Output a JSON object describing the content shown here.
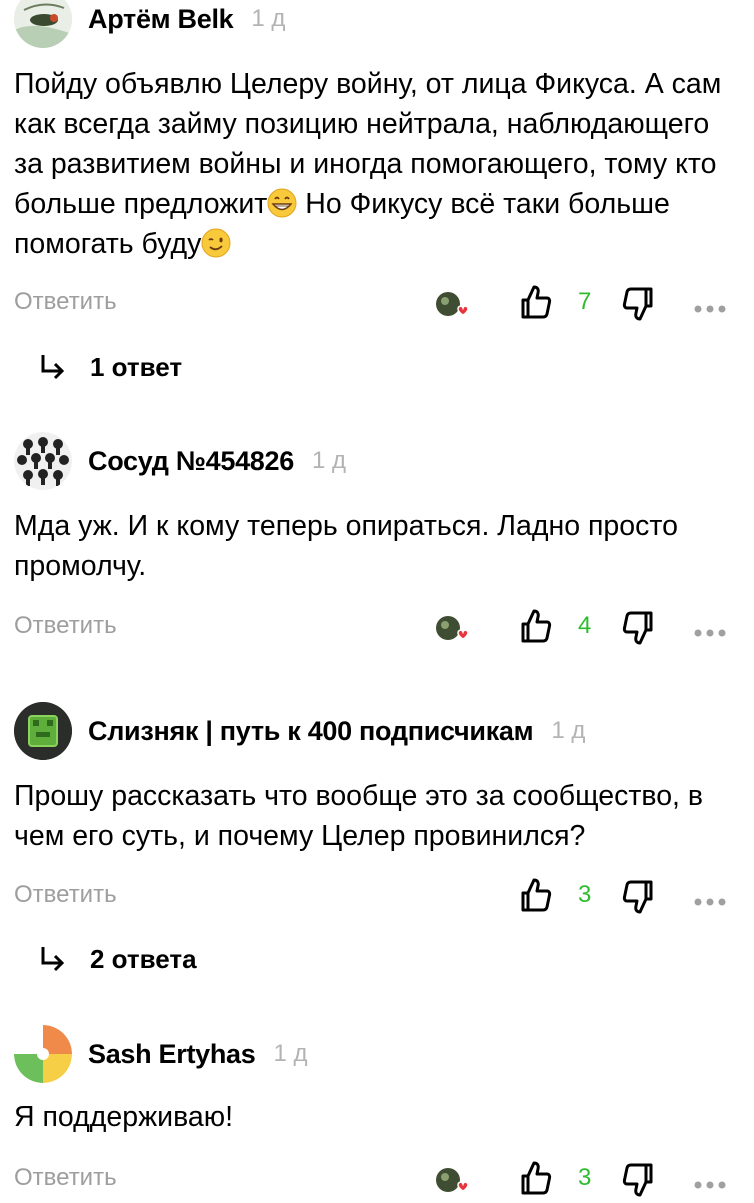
{
  "comments": [
    {
      "author": "Артём Belk",
      "age": "1 д",
      "text_parts": [
        "Пойду объявлю Целеру войну, от лица Фикуса. А сам как всегда займу позицию нейтрала, наблюдающего за развитием войны и иногда помогающего, тому кто больше предложит",
        " Но Фикусу всё таки больше помогать буду"
      ],
      "emojis": [
        "grinning-emoji",
        "winking-emoji"
      ],
      "reply_label": "Ответить",
      "likes": "7",
      "replies_label": "1 ответ"
    },
    {
      "author": "Сосуд №454826",
      "age": "1 д",
      "text": "Мда уж. И к кому теперь опираться. Ладно просто промолчу.",
      "reply_label": "Ответить",
      "likes": "4"
    },
    {
      "author": "Слизняк | путь к 400 подписчикам",
      "age": "1 д",
      "text": "Прошу рассказать что вообще это за сообщество, в чем его суть, и почему Целер провинился?",
      "reply_label": "Ответить",
      "likes": "3",
      "replies_label": "2 ответа"
    },
    {
      "author": "Sash Ertyhas",
      "age": "1 д",
      "text": "Я поддерживаю!",
      "reply_label": "Ответить",
      "likes": "3"
    }
  ],
  "colors": {
    "like_count": "#2ebc2e",
    "muted_text": "#9e9e9e",
    "age_text": "#b3b3b3",
    "heart": "#e8343b"
  },
  "icons": [
    "thumbs-up-icon",
    "thumbs-down-icon",
    "more-icon",
    "reply-arrow-icon",
    "liked-by-avatar-icon"
  ]
}
